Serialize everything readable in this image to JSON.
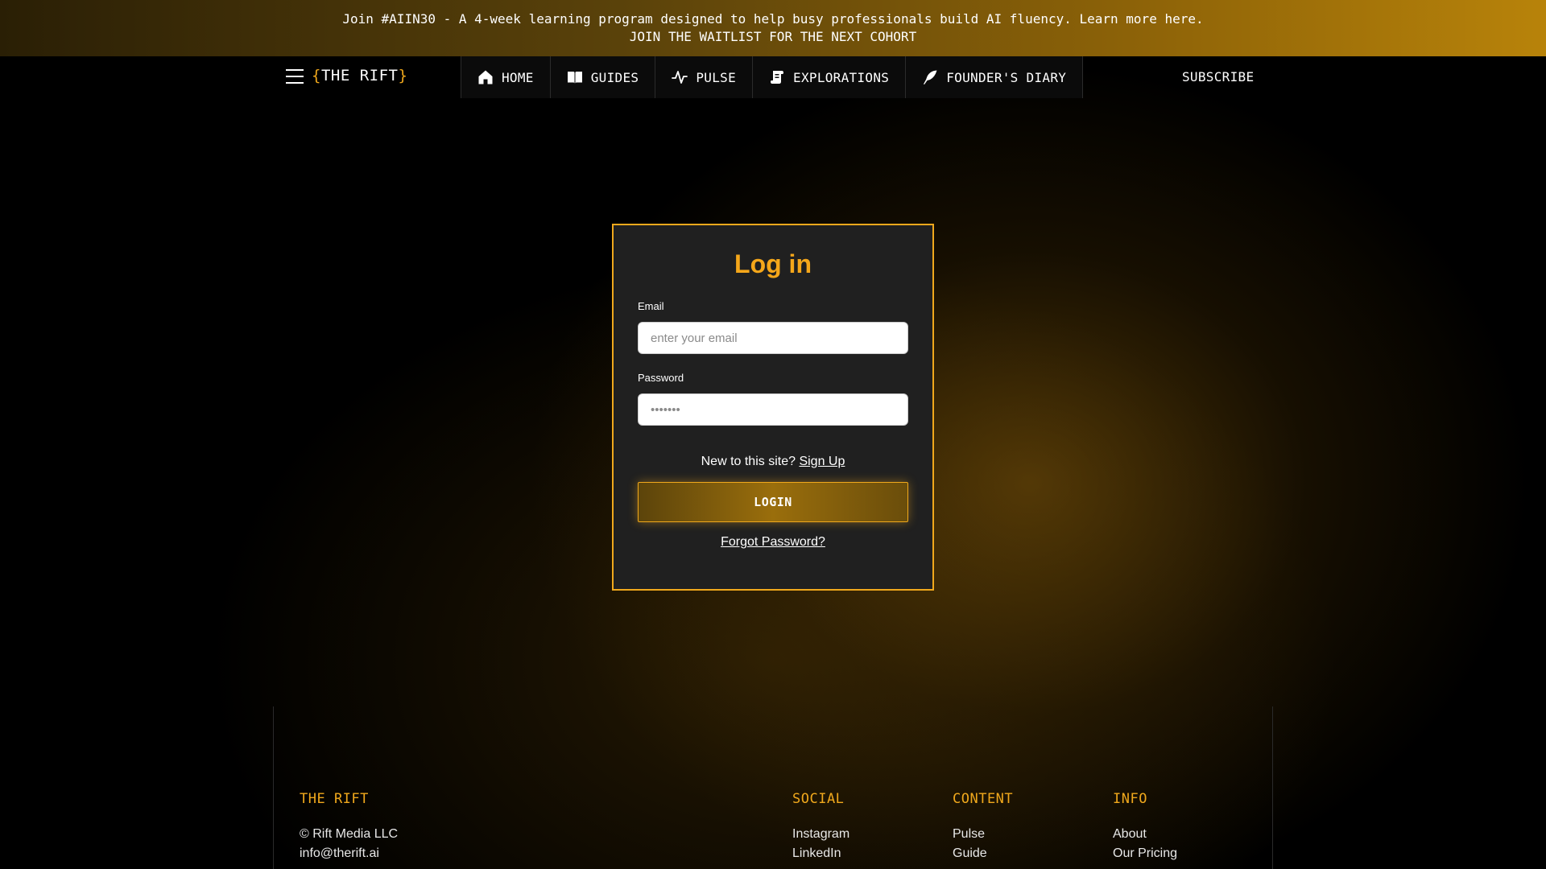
{
  "banner": {
    "line1": "Join #AIIN30 - A 4-week learning program designed to help busy professionals build AI fluency. Learn more here.",
    "line2": "JOIN THE WAITLIST FOR THE NEXT COHORT"
  },
  "header": {
    "logo_open": "{",
    "logo_text": "THE RIFT",
    "logo_close": "}",
    "nav": [
      {
        "label": "HOME",
        "icon": "home-icon"
      },
      {
        "label": "GUIDES",
        "icon": "book-icon"
      },
      {
        "label": "PULSE",
        "icon": "pulse-icon"
      },
      {
        "label": "EXPLORATIONS",
        "icon": "scroll-icon"
      },
      {
        "label": "FOUNDER'S DIARY",
        "icon": "quill-icon"
      }
    ],
    "subscribe": "SUBSCRIBE"
  },
  "login": {
    "title": "Log in",
    "email_label": "Email",
    "email_placeholder": "enter your email",
    "password_label": "Password",
    "password_placeholder": "•••••••",
    "signup_prompt": "New to this site?",
    "signup_link": "Sign Up",
    "login_button": "LOGIN",
    "forgot_link": "Forgot Password?"
  },
  "footer": {
    "brand": {
      "heading": "THE RIFT",
      "copyright": "© Rift Media LLC",
      "email": "info@therift.ai"
    },
    "social": {
      "heading": "SOCIAL",
      "links": [
        "Instagram",
        "LinkedIn"
      ]
    },
    "content": {
      "heading": "CONTENT",
      "links": [
        "Pulse",
        "Guide"
      ]
    },
    "info": {
      "heading": "INFO",
      "links": [
        "About",
        "Our Pricing"
      ]
    }
  },
  "colors": {
    "accent": "#f0a81c",
    "card_bg": "#202020",
    "page_bg": "#000000"
  }
}
